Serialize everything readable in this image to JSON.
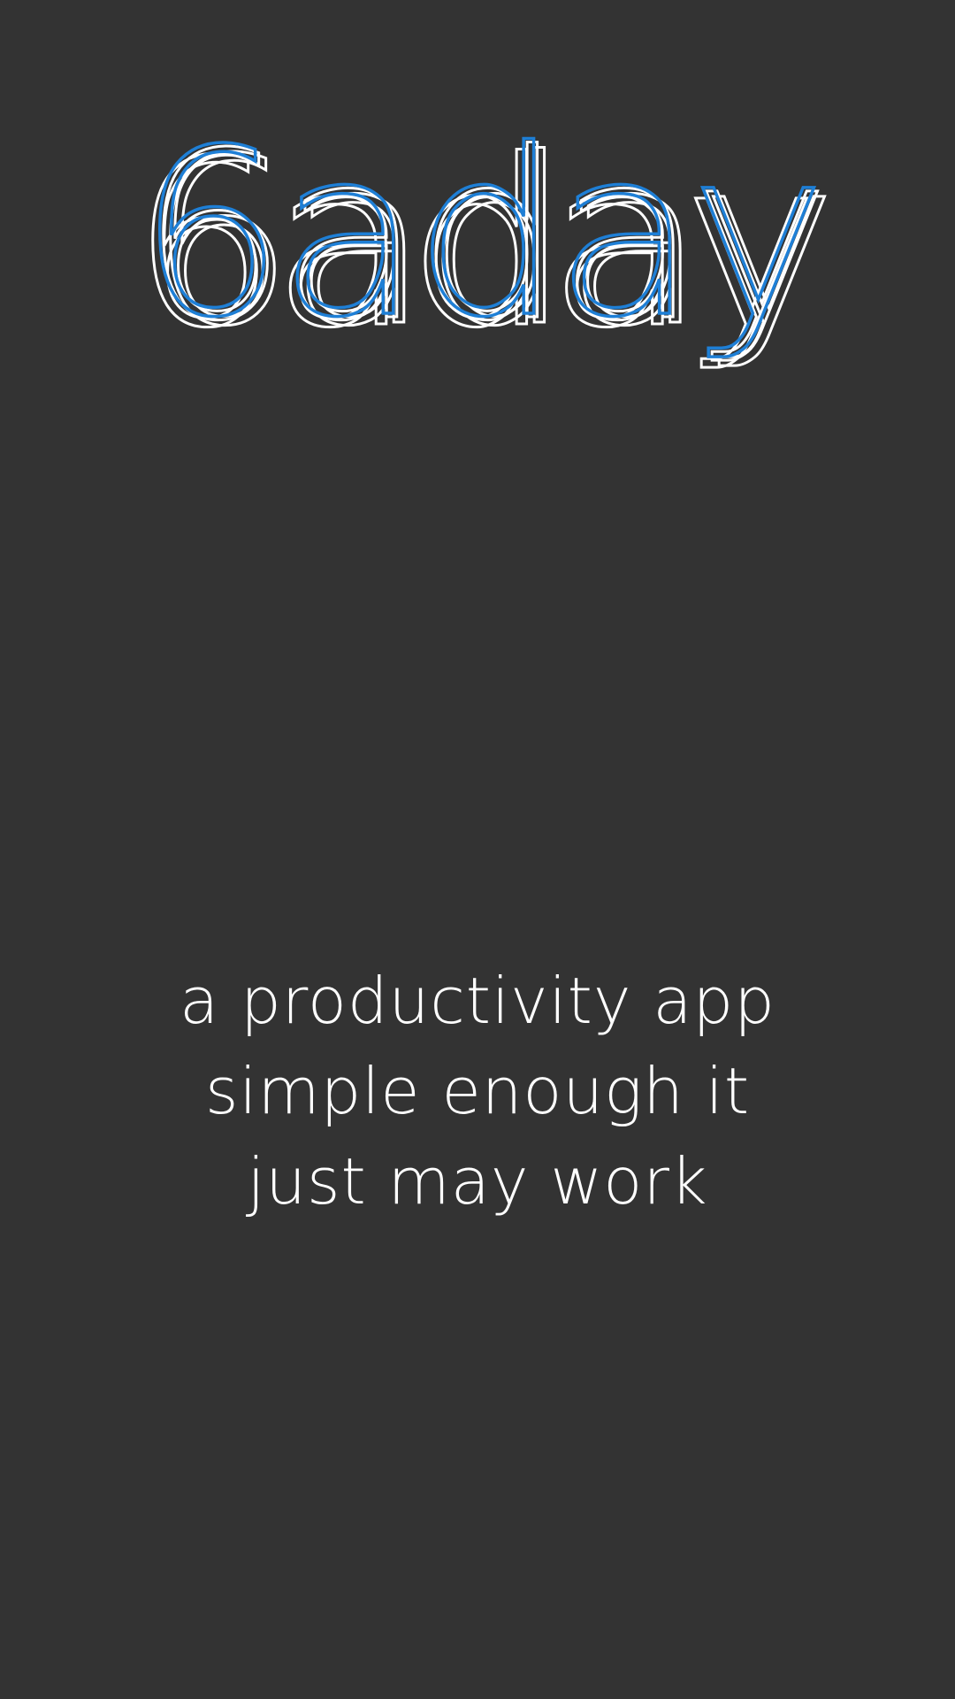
{
  "app": {
    "logo_text": "6aday",
    "accent_color": "#1e7fd6",
    "background_color": "#333333",
    "text_color": "#ffffff"
  },
  "tagline": {
    "lines": [
      "a productivity app",
      "simple enough it",
      "just may work"
    ]
  }
}
